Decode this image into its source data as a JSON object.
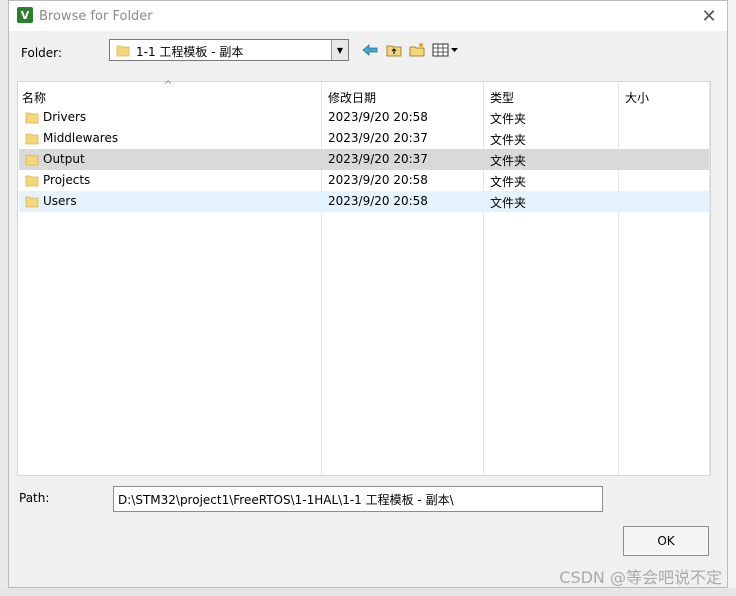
{
  "window": {
    "title": "Browse for Folder",
    "app_icon_letter": "V",
    "close_symbol": "✕"
  },
  "folder": {
    "label": "Folder:",
    "current": "1-1 工程模板 - 副本"
  },
  "toolbar": {
    "icons": [
      "back-icon",
      "up-folder-icon",
      "new-folder-icon",
      "view-menu-icon"
    ]
  },
  "list": {
    "columns": [
      "名称",
      "修改日期",
      "类型",
      "大小"
    ],
    "rows": [
      {
        "name": "Drivers",
        "modified": "2023/9/20 20:58",
        "type": "文件夹",
        "size": ""
      },
      {
        "name": "Middlewares",
        "modified": "2023/9/20 20:37",
        "type": "文件夹",
        "size": ""
      },
      {
        "name": "Output",
        "modified": "2023/9/20 20:37",
        "type": "文件夹",
        "size": ""
      },
      {
        "name": "Projects",
        "modified": "2023/9/20 20:58",
        "type": "文件夹",
        "size": ""
      },
      {
        "name": "Users",
        "modified": "2023/9/20 20:58",
        "type": "文件夹",
        "size": ""
      }
    ],
    "selected_row": "Output",
    "hover_row": "Users"
  },
  "path": {
    "label": "Path:",
    "value": "D:\\STM32\\project1\\FreeRTOS\\1-1HAL\\1-1 工程模板 - 副本\\"
  },
  "buttons": {
    "ok": "OK"
  },
  "watermark": "CSDN @等会吧说不定",
  "colors": {
    "selected": "#d9d9d9",
    "hover": "#e5f3ff",
    "folder": "#f5d67a"
  }
}
